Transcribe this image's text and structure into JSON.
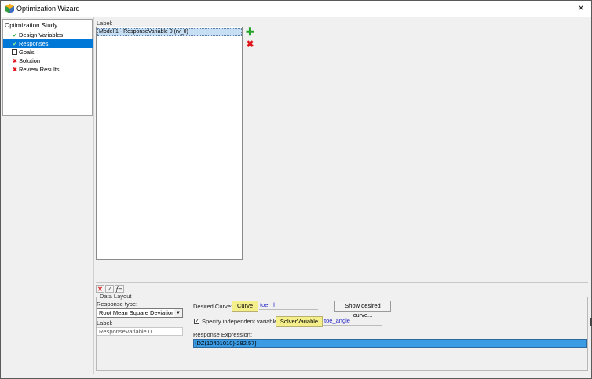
{
  "window": {
    "title": "Optimization Wizard",
    "close_glyph": "✕"
  },
  "tree": {
    "root": "Optimization Study",
    "items": [
      {
        "label": "Design Variables",
        "icon": "check-icon",
        "selected": false
      },
      {
        "label": "Responses",
        "icon": "check-icon",
        "selected": true
      },
      {
        "label": "Goals",
        "icon": "checkbox-empty-icon",
        "selected": false
      },
      {
        "label": "Solution",
        "icon": "x-icon",
        "selected": false
      },
      {
        "label": "Review Results",
        "icon": "x-icon",
        "selected": false
      }
    ]
  },
  "responses": {
    "label_caption": "Label:",
    "items": [
      "Model 1 - ResponseVariable 0 (rv_0)"
    ],
    "add_glyph": "✚",
    "remove_glyph": "✖"
  },
  "mini_toolbar": {
    "delete_glyph": "✕",
    "apply_glyph": "✓",
    "function_glyph": "f="
  },
  "data_layout": {
    "caption": "Data Layout",
    "response_type_label": "Response type:",
    "response_type_value": "Root Mean Square Deviation",
    "label_label": "Label:",
    "label_value": "ResponseVariable 0",
    "desired_curve_label": "Desired Curve:",
    "curve_button": "Curve",
    "curve_value": "toe_rh",
    "show_curve_button": "Show desired curve...",
    "specify_independent_label": "Specify independent variable",
    "specify_independent_checked": true,
    "solver_variable_button": "SolverVariable",
    "solver_variable_value": "toe_angle",
    "response_expression_label": "Response Expression:",
    "response_expression_value": "{DZ(10401010)-282.57}"
  },
  "colors": {
    "selection": "#0078d7",
    "accent_yellow": "#f5ef8b",
    "entity_text": "#2525c8",
    "check_green": "#25a52a",
    "error_red": "#e0161b"
  }
}
